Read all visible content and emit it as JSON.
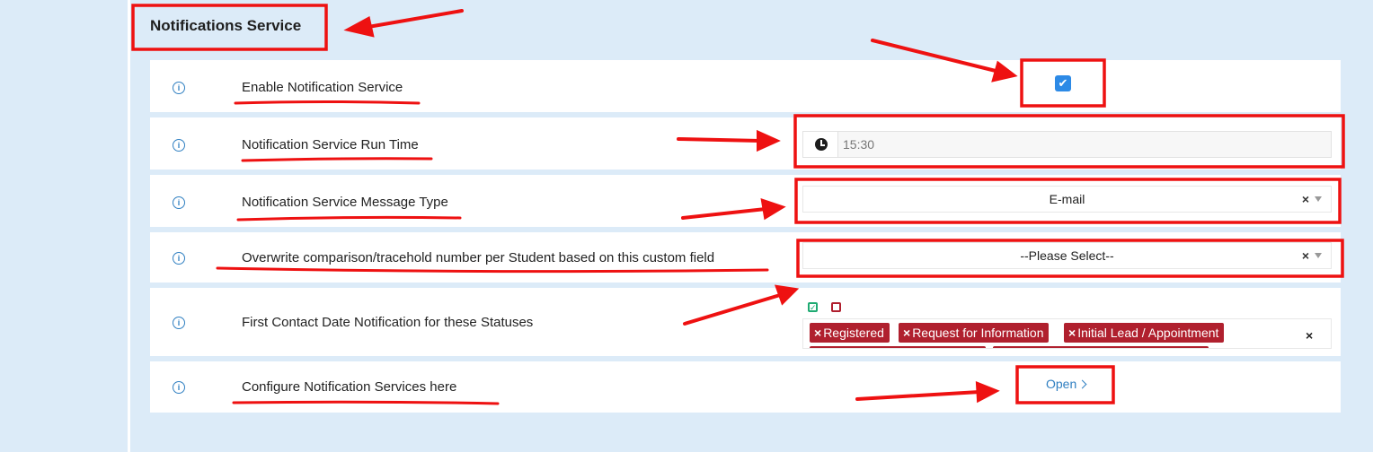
{
  "section": {
    "title": "Notifications Service"
  },
  "rows": {
    "enable": {
      "label": "Enable Notification Service",
      "checked": true,
      "check_glyph": "✔"
    },
    "run_time": {
      "label": "Notification Service Run Time",
      "value": "15:30",
      "icon": "clock-icon"
    },
    "message_type": {
      "label": "Notification Service Message Type",
      "selected": "E-mail",
      "clear": "×"
    },
    "overwrite_field": {
      "label": "Overwrite comparison/tracehold number per Student based on this custom field",
      "selected": "--Please Select--",
      "clear": "×"
    },
    "first_contact": {
      "label": "First Contact Date Notification for these Statuses",
      "select_all_glyph": "✓",
      "tags": [
        "Registered",
        "Request for Information",
        "Initial Lead / Appointment"
      ],
      "tag_remove": "×",
      "clear": "×"
    },
    "configure": {
      "label": "Configure Notification Services here",
      "link_label": "Open"
    }
  },
  "info_glyph": "i",
  "colors": {
    "background": "#dcebf8",
    "accent_blue": "#2f7fc1",
    "checkbox_blue": "#2d8ae6",
    "tag_red": "#b0202e",
    "annotation_red": "#ee1111",
    "select_all_green": "#1eaa72"
  }
}
